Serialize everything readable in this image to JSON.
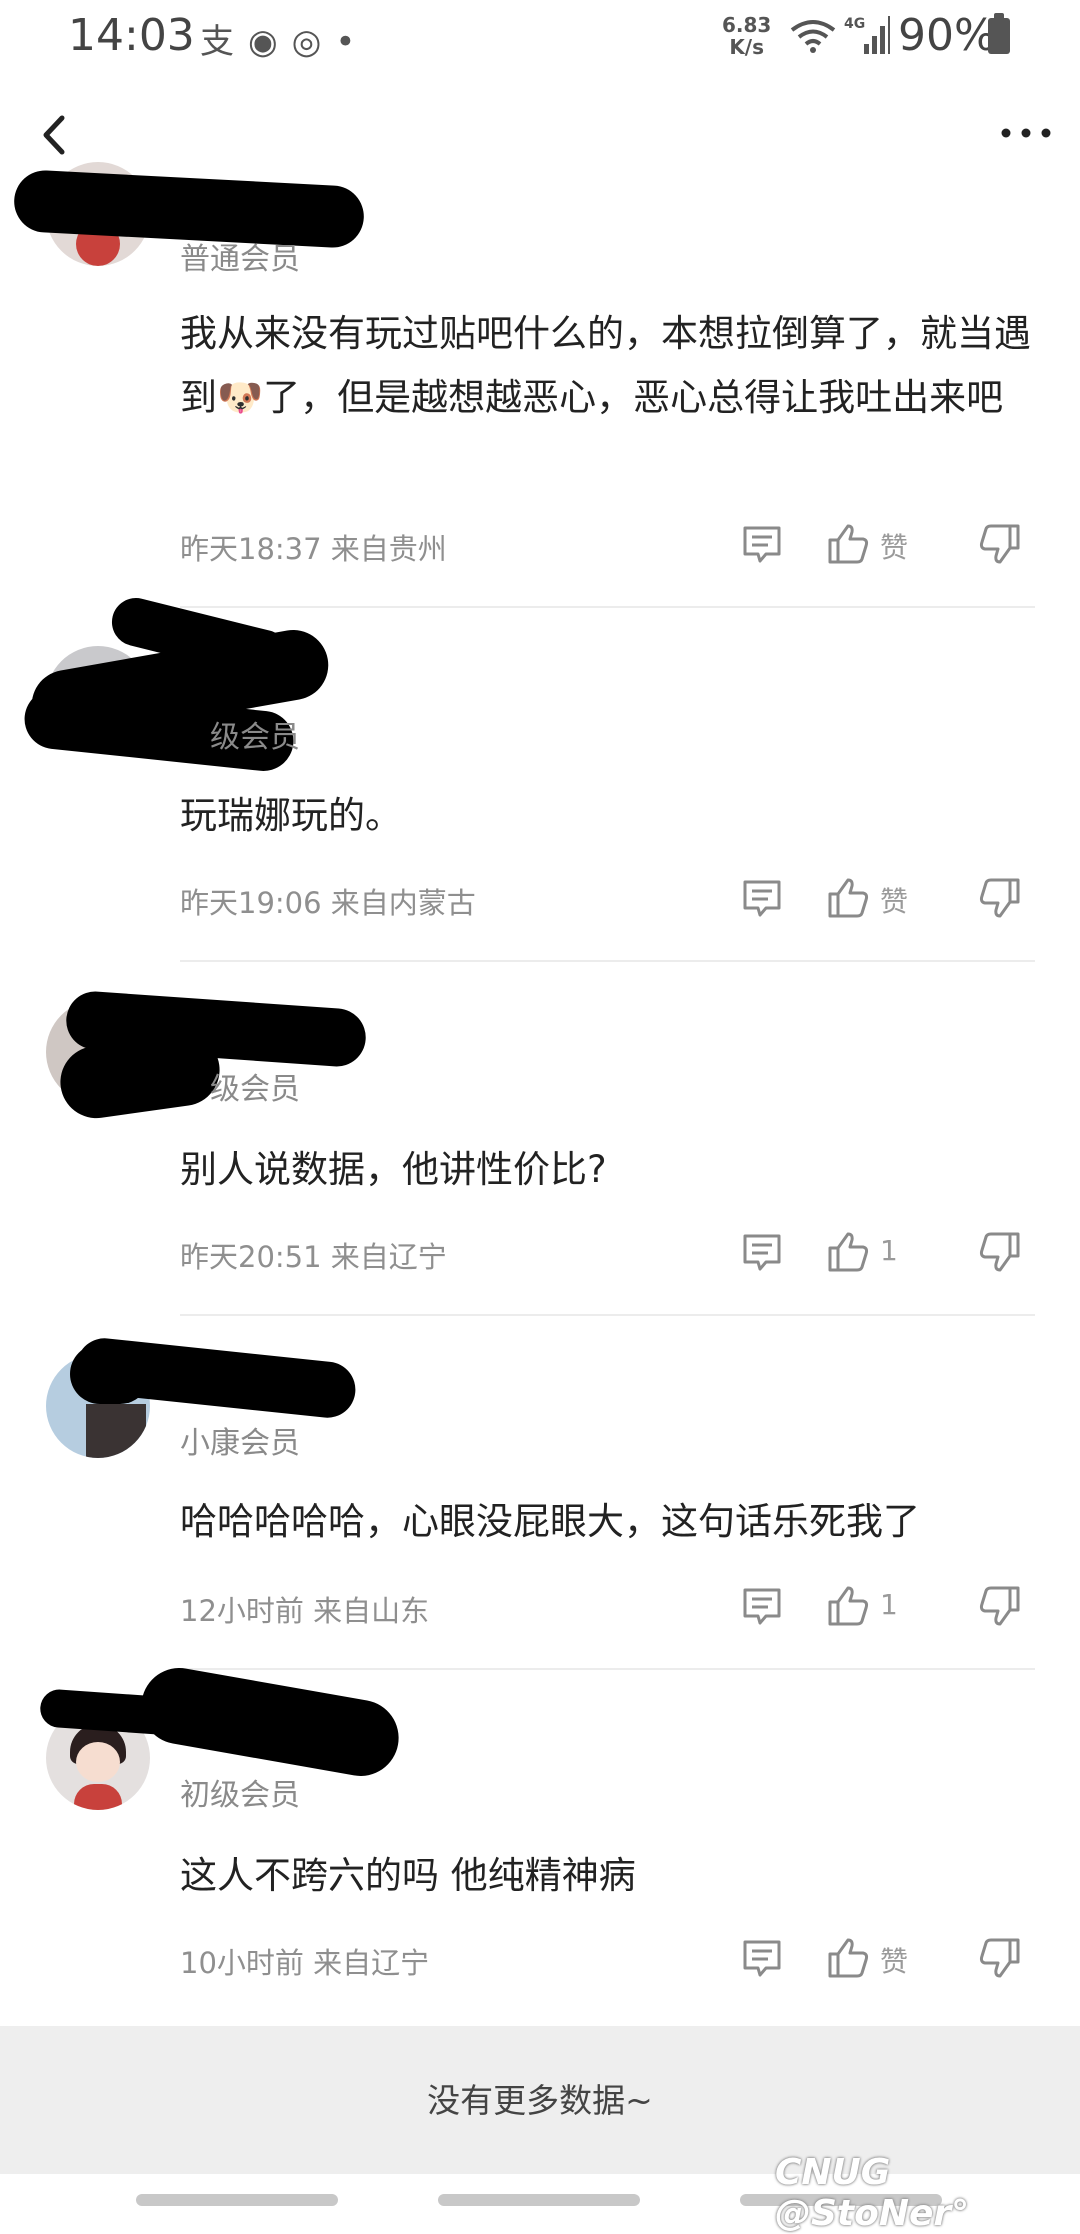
{
  "status_bar": {
    "time": "14:03",
    "net_speed_value": "6.83",
    "net_speed_unit": "K/s",
    "network_type": "4G",
    "battery": "90%",
    "left_icons": [
      "alipay-icon",
      "app-icon",
      "app-icon-2",
      "dot-icon"
    ]
  },
  "comments": [
    {
      "level": "普通会员",
      "content": "我从来没有玩过贴吧什么的，本想拉倒算了，就当遇到🐶了，但是越想越恶心，恶心总得让我吐出来吧",
      "time_location": "昨天18:37 来自贵州",
      "like_label": "赞"
    },
    {
      "level": "级会员",
      "content": "玩瑞娜玩的。",
      "time_location": "昨天19:06 来自内蒙古",
      "like_label": "赞"
    },
    {
      "level": "级会员",
      "content": "别人说数据，他讲性价比?",
      "time_location": "昨天20:51 来自辽宁",
      "like_label": "1"
    },
    {
      "level": "小康会员",
      "content": "哈哈哈哈哈，心眼没屁眼大，这句话乐死我了",
      "time_location": "12小时前 来自山东",
      "like_label": "1"
    },
    {
      "level": "初级会员",
      "content": "这人不跨六的吗 他纯精神病",
      "time_location": "10小时前 来自辽宁",
      "like_label": "赞"
    }
  ],
  "footer": {
    "no_more": "没有更多数据~"
  },
  "watermark": "CNUG @StoNer°"
}
